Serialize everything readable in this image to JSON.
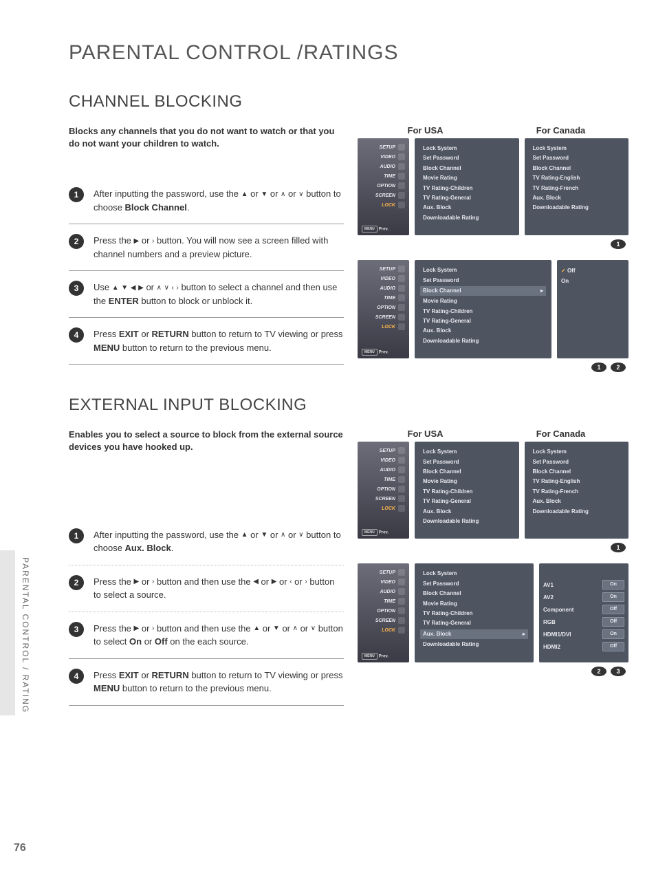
{
  "page_number": "76",
  "side_label": "PARENTAL CONTROL / RATING",
  "main_title": "PARENTAL CONTROL /RATINGS",
  "section1": {
    "title": "CHANNEL BLOCKING",
    "intro": "Blocks any channels that you do not want to watch or that you do not want your children to watch.",
    "steps": {
      "s1a": "After inputting the password, use the ",
      "s1b": " or ",
      "s1c": "  or  ",
      "s1d": " or  ",
      "s1e": "  button to choose ",
      "s1f": "Block Channel",
      "s1g": ".",
      "s2a": "Press the ",
      "s2b": "  or  ",
      "s2c": "  button. You will now see a screen filled with channel numbers and a preview picture.",
      "s3a": "Use ",
      "s3b": " or ",
      "s3c": "  button to select a channel and then use the ",
      "s3d": "ENTER",
      "s3e": " button to block or unblock it.",
      "s4a": "Press ",
      "s4b": "EXIT",
      "s4c": " or ",
      "s4d": "RETURN",
      "s4e": " button to return to TV viewing or press ",
      "s4f": "MENU",
      "s4g": " button to return to the previous menu."
    }
  },
  "section2": {
    "title": "EXTERNAL INPUT BLOCKING",
    "intro": "Enables you to select a source to block from the external source devices you have hooked up.",
    "steps": {
      "s1a": "After inputting the password, use the ",
      "s1b": " or ",
      "s1c": "  or  ",
      "s1d": " or  ",
      "s1e": "  button to choose ",
      "s1f": "Aux. Block",
      "s1g": ".",
      "s2a": "Press the ",
      "s2b": "  or  ",
      "s2c": "  button and then use the ",
      "s2d": " or ",
      "s2e": " or  ",
      "s2f": "  or  ",
      "s2g": "  button  to select a source.",
      "s3a": "Press the ",
      "s3b": "  or  ",
      "s3c": "  button and then use the ",
      "s3d": " or ",
      "s3e": " or  ",
      "s3f": "  or  ",
      "s3g": "  button to select ",
      "s3h": "On",
      "s3i": " or ",
      "s3j": "Off",
      "s3k": " on the each source.",
      "s4a": "Press ",
      "s4b": "EXIT",
      "s4c": " or ",
      "s4d": "RETURN",
      "s4e": " button to return to TV viewing or press ",
      "s4f": "MENU",
      "s4g": " button to return to the previous menu."
    }
  },
  "labels": {
    "usa": "For USA",
    "canada": "For Canada"
  },
  "sidebar_items": [
    "SETUP",
    "VIDEO",
    "AUDIO",
    "TIME",
    "OPTION",
    "SCREEN",
    "LOCK"
  ],
  "sidebar_prev_chip": "MENU",
  "sidebar_prev_text": "Prev.",
  "lock_menu_usa": [
    "Lock System",
    "Set Password",
    "Block Channel",
    "Movie Rating",
    "TV Rating-Children",
    "TV Rating-General",
    "Aux. Block",
    "Downloadable Rating"
  ],
  "lock_menu_canada": [
    "Lock System",
    "Set Password",
    "Block Channel",
    "TV Rating-English",
    "TV Rating-French",
    "Aux. Block",
    "Downloadable Rating"
  ],
  "block_options": {
    "off": "Off",
    "on": "On"
  },
  "aux_rows": [
    {
      "label": "AV1",
      "state": "On"
    },
    {
      "label": "AV2",
      "state": "On"
    },
    {
      "label": "Component",
      "state": "Off"
    },
    {
      "label": "RGB",
      "state": "Off"
    },
    {
      "label": "HDMI1/DVI",
      "state": "On"
    },
    {
      "label": "HDMI2",
      "state": "Off"
    }
  ],
  "bullets": {
    "1": "1",
    "2": "2",
    "3": "3",
    "4": "4"
  }
}
